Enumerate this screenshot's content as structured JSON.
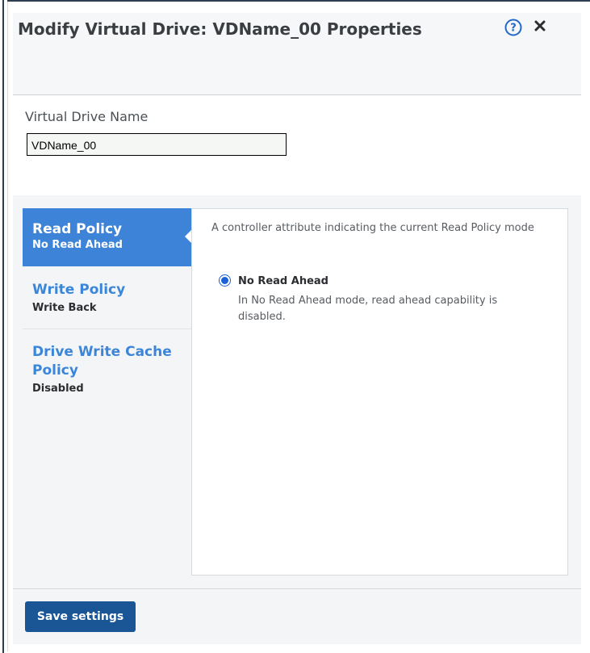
{
  "dialog": {
    "title": "Modify Virtual Drive: VDName_00 Properties",
    "help_icon": "question-circle-icon",
    "close_icon": "close-icon"
  },
  "name_field": {
    "label": "Virtual Drive Name",
    "value": "VDName_00"
  },
  "tabs": [
    {
      "title": "Read Policy",
      "value": "No Read Ahead",
      "active": true
    },
    {
      "title": "Write Policy",
      "value": "Write Back",
      "active": false
    },
    {
      "title": "Drive Write Cache Policy",
      "value": "Disabled",
      "active": false
    }
  ],
  "content": {
    "description": "A controller attribute indicating the current Read Policy mode",
    "option": {
      "label": "No Read Ahead",
      "description": "In No Read Ahead mode, read ahead capability is disabled.",
      "checked": true
    }
  },
  "footer": {
    "save_label": "Save settings"
  },
  "colors": {
    "accent": "#3d84d8",
    "primary_button": "#1a5596",
    "title_text": "#3a3d41"
  }
}
